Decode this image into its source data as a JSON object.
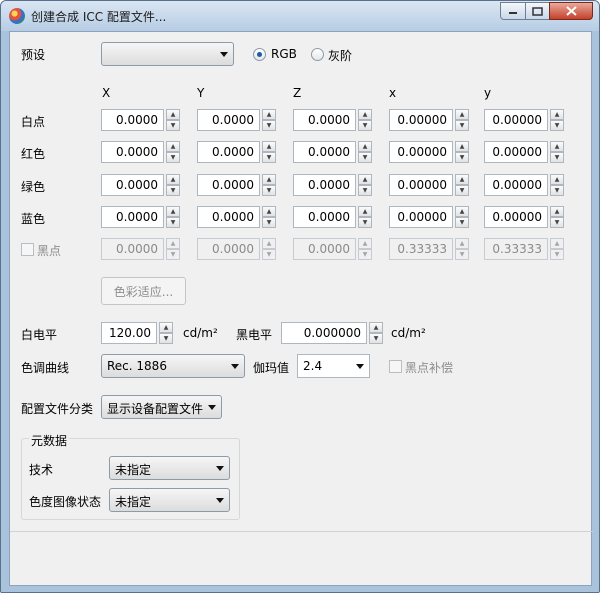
{
  "window": {
    "title": "创建合成 ICC 配置文件..."
  },
  "preset": {
    "label": "预设",
    "value": "",
    "rgb_label": "RGB",
    "gray_label": "灰阶",
    "selected": "RGB"
  },
  "columns": [
    "X",
    "Y",
    "Z",
    "x",
    "y"
  ],
  "rows": [
    {
      "label": "白点",
      "values": [
        "0.0000",
        "0.0000",
        "0.0000",
        "0.00000",
        "0.00000"
      ],
      "enabled": true
    },
    {
      "label": "红色",
      "values": [
        "0.0000",
        "0.0000",
        "0.0000",
        "0.00000",
        "0.00000"
      ],
      "enabled": true
    },
    {
      "label": "绿色",
      "values": [
        "0.0000",
        "0.0000",
        "0.0000",
        "0.00000",
        "0.00000"
      ],
      "enabled": true
    },
    {
      "label": "蓝色",
      "values": [
        "0.0000",
        "0.0000",
        "0.0000",
        "0.00000",
        "0.00000"
      ],
      "enabled": true
    },
    {
      "label": "黑点",
      "values": [
        "0.0000",
        "0.0000",
        "0.0000",
        "0.33333",
        "0.33333"
      ],
      "enabled": false,
      "checked": false
    }
  ],
  "chromatic_button": "色彩适应...",
  "white_level": {
    "label": "白电平",
    "value": "120.00",
    "unit": "cd/m²"
  },
  "black_level": {
    "label": "黑电平",
    "value": "0.000000",
    "unit": "cd/m²"
  },
  "tone_curve": {
    "label": "色调曲线",
    "value": "Rec. 1886"
  },
  "gamma": {
    "label": "伽玛值",
    "value": "2.4"
  },
  "black_compensation": {
    "label": "黑点补偿",
    "checked": false
  },
  "profile_class": {
    "label": "配置文件分类",
    "value": "显示设备配置文件"
  },
  "metadata": {
    "title": "元数据",
    "tech_label": "技术",
    "tech_value": "未指定",
    "colorimetric_label": "色度图像状态",
    "colorimetric_value": "未指定"
  },
  "colors": {
    "frame": "#a9c3dd",
    "client_bg": "#f0f0f0",
    "close_button": "#c4402a",
    "radio_dot": "#1e5ca8"
  }
}
